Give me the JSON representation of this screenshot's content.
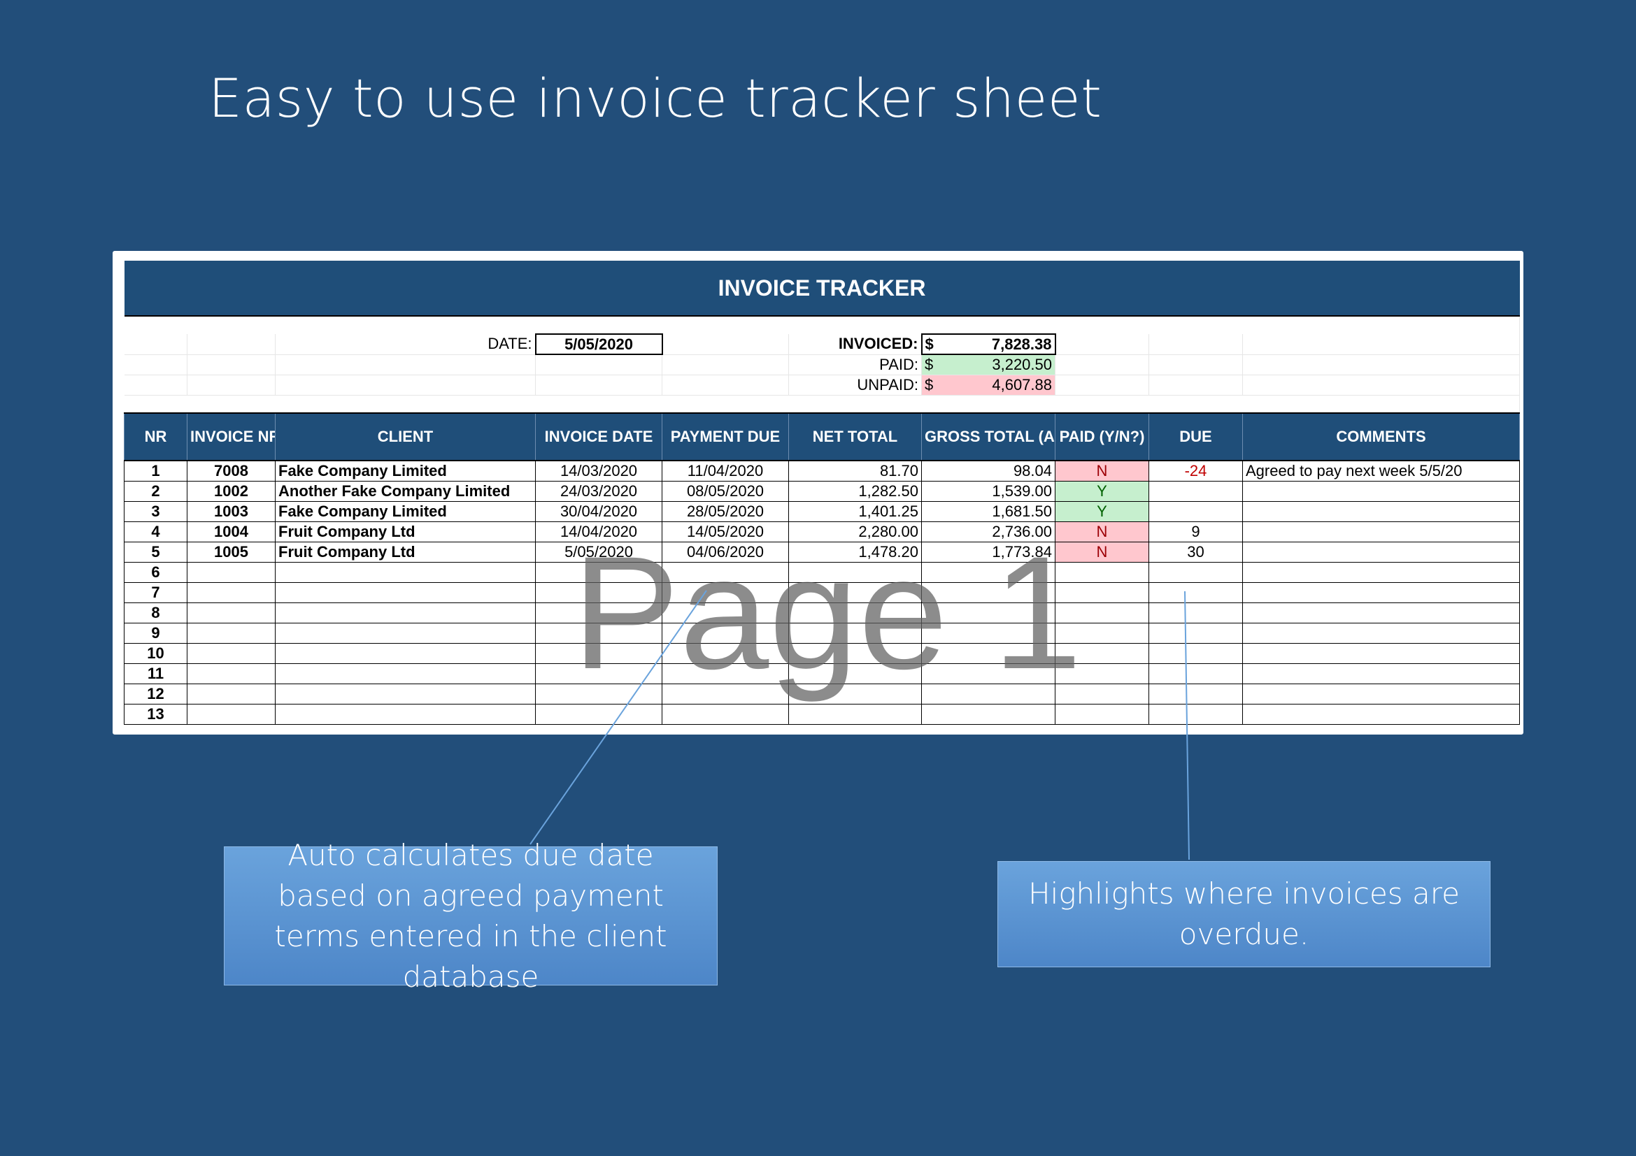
{
  "slide_title": "Easy to use invoice tracker sheet",
  "sheet": {
    "title": "INVOICE TRACKER",
    "summary": {
      "date_label": "DATE:",
      "date_value": "5/05/2020",
      "invoiced_label": "INVOICED:",
      "invoiced_currency": "$",
      "invoiced_value": "7,828.38",
      "paid_label": "PAID:",
      "paid_currency": "$",
      "paid_value": "3,220.50",
      "unpaid_label": "UNPAID:",
      "unpaid_currency": "$",
      "unpaid_value": "4,607.88"
    },
    "columns": {
      "nr": "NR",
      "invoice_nr": "INVOICE NR",
      "client": "CLIENT",
      "invoice_date": "INVOICE DATE",
      "payment_due": "PAYMENT DUE",
      "net_total": "NET TOTAL",
      "gross_total": "GROSS TOTAL (AFTER TAX)",
      "paid": "PAID (Y/N?)",
      "due": "DUE",
      "comments": "COMMENTS"
    },
    "rows": [
      {
        "nr": "1",
        "invoice_nr": "7008",
        "client": "Fake Company Limited",
        "invoice_date": "14/03/2020",
        "payment_due": "11/04/2020",
        "net_total": "81.70",
        "gross_total": "98.04",
        "paid": "N",
        "due": "-24",
        "comments": "Agreed to pay next week 5/5/20"
      },
      {
        "nr": "2",
        "invoice_nr": "1002",
        "client": "Another Fake Company Limited",
        "invoice_date": "24/03/2020",
        "payment_due": "08/05/2020",
        "net_total": "1,282.50",
        "gross_total": "1,539.00",
        "paid": "Y",
        "due": "",
        "comments": ""
      },
      {
        "nr": "3",
        "invoice_nr": "1003",
        "client": "Fake Company Limited",
        "invoice_date": "30/04/2020",
        "payment_due": "28/05/2020",
        "net_total": "1,401.25",
        "gross_total": "1,681.50",
        "paid": "Y",
        "due": "",
        "comments": ""
      },
      {
        "nr": "4",
        "invoice_nr": "1004",
        "client": "Fruit Company Ltd",
        "invoice_date": "14/04/2020",
        "payment_due": "14/05/2020",
        "net_total": "2,280.00",
        "gross_total": "2,736.00",
        "paid": "N",
        "due": "9",
        "comments": ""
      },
      {
        "nr": "5",
        "invoice_nr": "1005",
        "client": "Fruit Company Ltd",
        "invoice_date": "5/05/2020",
        "payment_due": "04/06/2020",
        "net_total": "1,478.20",
        "gross_total": "1,773.84",
        "paid": "N",
        "due": "30",
        "comments": ""
      },
      {
        "nr": "6",
        "invoice_nr": "",
        "client": "",
        "invoice_date": "",
        "payment_due": "",
        "net_total": "",
        "gross_total": "",
        "paid": "",
        "due": "",
        "comments": ""
      },
      {
        "nr": "7",
        "invoice_nr": "",
        "client": "",
        "invoice_date": "",
        "payment_due": "",
        "net_total": "",
        "gross_total": "",
        "paid": "",
        "due": "",
        "comments": ""
      },
      {
        "nr": "8",
        "invoice_nr": "",
        "client": "",
        "invoice_date": "",
        "payment_due": "",
        "net_total": "",
        "gross_total": "",
        "paid": "",
        "due": "",
        "comments": ""
      },
      {
        "nr": "9",
        "invoice_nr": "",
        "client": "",
        "invoice_date": "",
        "payment_due": "",
        "net_total": "",
        "gross_total": "",
        "paid": "",
        "due": "",
        "comments": ""
      },
      {
        "nr": "10",
        "invoice_nr": "",
        "client": "",
        "invoice_date": "",
        "payment_due": "",
        "net_total": "",
        "gross_total": "",
        "paid": "",
        "due": "",
        "comments": ""
      },
      {
        "nr": "11",
        "invoice_nr": "",
        "client": "",
        "invoice_date": "",
        "payment_due": "",
        "net_total": "",
        "gross_total": "",
        "paid": "",
        "due": "",
        "comments": ""
      },
      {
        "nr": "12",
        "invoice_nr": "",
        "client": "",
        "invoice_date": "",
        "payment_due": "",
        "net_total": "",
        "gross_total": "",
        "paid": "",
        "due": "",
        "comments": ""
      },
      {
        "nr": "13",
        "invoice_nr": "",
        "client": "",
        "invoice_date": "",
        "payment_due": "",
        "net_total": "",
        "gross_total": "",
        "paid": "",
        "due": "",
        "comments": ""
      }
    ],
    "watermark": "Page 1"
  },
  "callouts": {
    "due_date": "Auto calculates due date based on agreed payment terms entered in the client database",
    "overdue": "Highlights where invoices are overdue."
  },
  "colors": {
    "background": "#224e7a",
    "header": "#1f4e79",
    "paid_green": "#c6efce",
    "unpaid_red": "#ffc7ce",
    "overdue_text": "#c00000",
    "callout": "#5b96d3"
  }
}
